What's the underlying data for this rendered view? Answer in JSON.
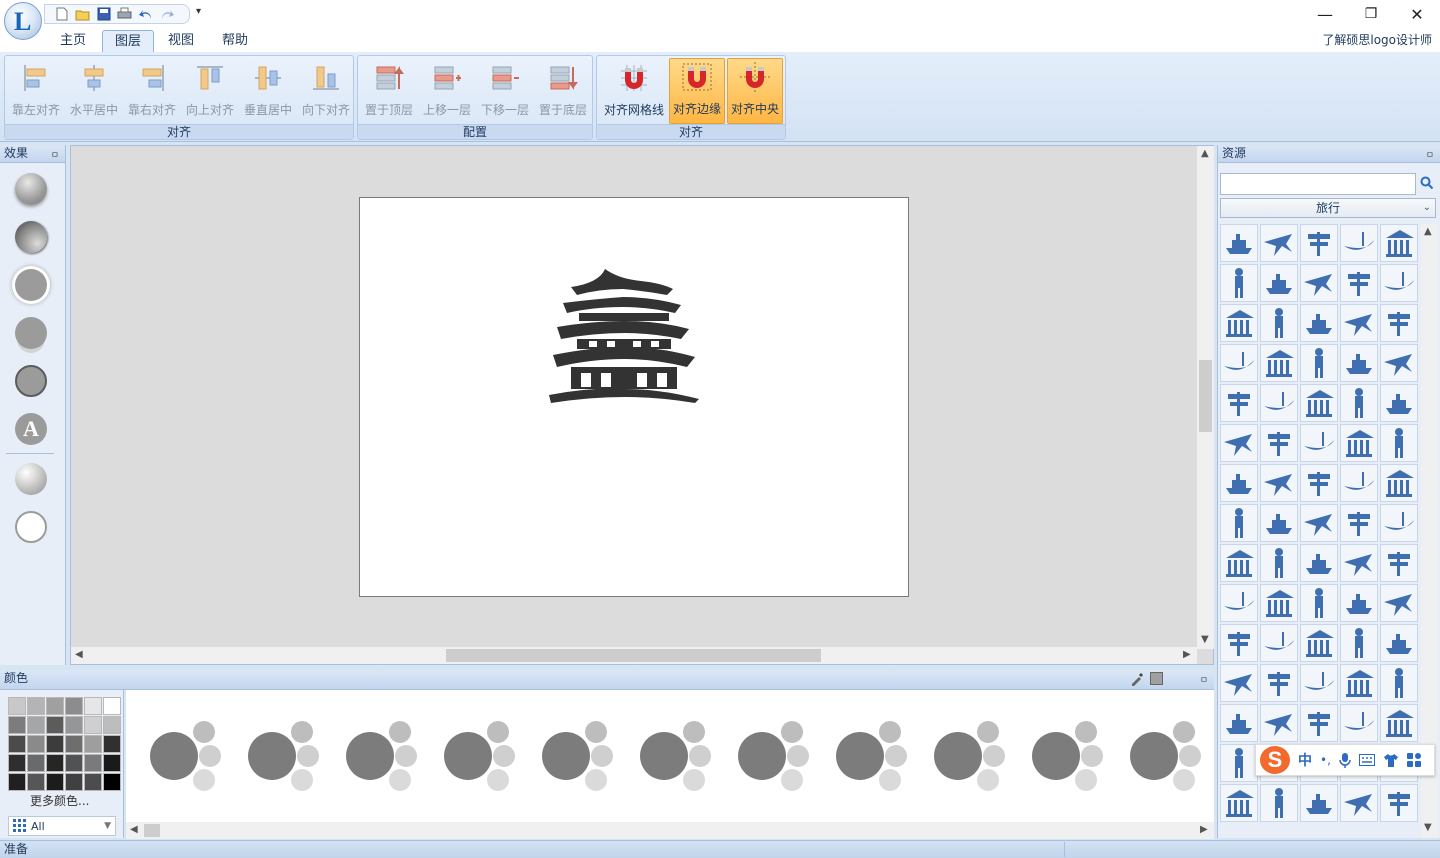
{
  "app": {
    "about_link": "了解硕思logo设计师"
  },
  "quick_access": {
    "icons": [
      "new-file-icon",
      "open-folder-icon",
      "save-icon",
      "print-icon",
      "undo-icon",
      "redo-icon"
    ],
    "more": "▾"
  },
  "window_controls": {
    "minimize": "—",
    "maximize": "❐",
    "close": "✕"
  },
  "tabs": [
    {
      "label": "主页",
      "active": false
    },
    {
      "label": "图层",
      "active": true
    },
    {
      "label": "视图",
      "active": false
    },
    {
      "label": "帮助",
      "active": false
    }
  ],
  "ribbon": {
    "groups": [
      {
        "label": "对齐",
        "buttons": [
          {
            "label": "靠左对齐"
          },
          {
            "label": "水平居中"
          },
          {
            "label": "靠右对齐"
          },
          {
            "label": "向上对齐"
          },
          {
            "label": "垂直居中"
          },
          {
            "label": "向下对齐"
          }
        ]
      },
      {
        "label": "配置",
        "buttons": [
          {
            "label": "置于顶层"
          },
          {
            "label": "上移一层"
          },
          {
            "label": "下移一层"
          },
          {
            "label": "置于底层"
          }
        ]
      },
      {
        "label": "对齐",
        "buttons": [
          {
            "label": "对齐网格线"
          },
          {
            "label": "对齐边缘"
          },
          {
            "label": "对齐中央"
          }
        ]
      }
    ]
  },
  "effects_panel": {
    "title": "效果",
    "pin": "ㅁ",
    "text_effect_glyph": "A"
  },
  "colors_panel": {
    "title": "颜色",
    "more_colors": "更多颜色...",
    "filter_value": "All",
    "swatches": [
      "#c8c8c8",
      "#b4b4b4",
      "#a0a0a0",
      "#8c8c8c",
      "#e6e6e6",
      "#ffffff",
      "#7c7c7c",
      "#a6a6a6",
      "#5c5c5c",
      "#969696",
      "#cfcfcf",
      "#bdbdbd",
      "#4b4b4b",
      "#8a8a8a",
      "#3c3c3c",
      "#6e6e6e",
      "#9e9e9e",
      "#303030",
      "#2e2e2e",
      "#6a6a6a",
      "#262626",
      "#525252",
      "#7a7a7a",
      "#1a1a1a",
      "#202020",
      "#565656",
      "#1c1c1c",
      "#404040",
      "#4c4c4c",
      "#000000"
    ],
    "scheme_count": 11
  },
  "resources_panel": {
    "title": "资源",
    "search_value": "",
    "category": "旅行",
    "items": [
      "cruise-ship-icon",
      "airplane-icon",
      "signpost-icon",
      "gondola-icon",
      "temple-icon",
      "pharaoh-icon",
      "palm-figure-icon",
      "pyramids-icon",
      "sphinx-icon",
      "boat-icon",
      "camel-icon",
      "palm-tree-icon",
      "palm-tree-icon",
      "plane-icon",
      "eiffel-tower-icon",
      "tower-icon",
      "compass-icon",
      "telescope-icon",
      "anchor-icon",
      "ship-wheel-icon",
      "globe-icon",
      "eiffel-tower-icon",
      "paper-plane-icon",
      "opera-house-icon",
      "city-skyline-icon",
      "taj-mahal-icon",
      "church-icon",
      "liberty-icon",
      "colosseum-icon",
      "torii-gate-icon",
      "house-icon",
      "beach-icon",
      "deer-icon",
      "castle-icon",
      "wave-icon",
      "space-needle-icon",
      "pagoda-icon",
      "pavilion-icon",
      "parthenon-icon",
      "landmark-icon",
      "statue-icon",
      "pagoda-icon",
      "statue-icon",
      "ruins-icon",
      "tower-icon",
      "ring-icon",
      "tower-icon",
      "columns-icon",
      "sydney-icon",
      "windmill-icon",
      "pyramid-icon",
      "cathedral-icon",
      "castle-icon",
      "building-icon",
      "pavilion-icon",
      "gate-icon",
      "cottage-icon",
      "palm-tree-icon",
      "lighthouse-icon",
      "dome-icon",
      "pagoda-icon",
      "bus-icon",
      "tower-icon",
      "lighthouse-icon",
      "lighthouse-icon",
      "bridge-icon",
      "villa-icon",
      "palace-icon",
      "pagoda-icon",
      "castle-icon",
      "gazebo-icon",
      "house-icon",
      "ruins-icon",
      "dome-icon",
      "temple-icon"
    ]
  },
  "ime": {
    "logo": "S",
    "mode": "中",
    "punct": "•,"
  },
  "status": {
    "text": "准备"
  }
}
